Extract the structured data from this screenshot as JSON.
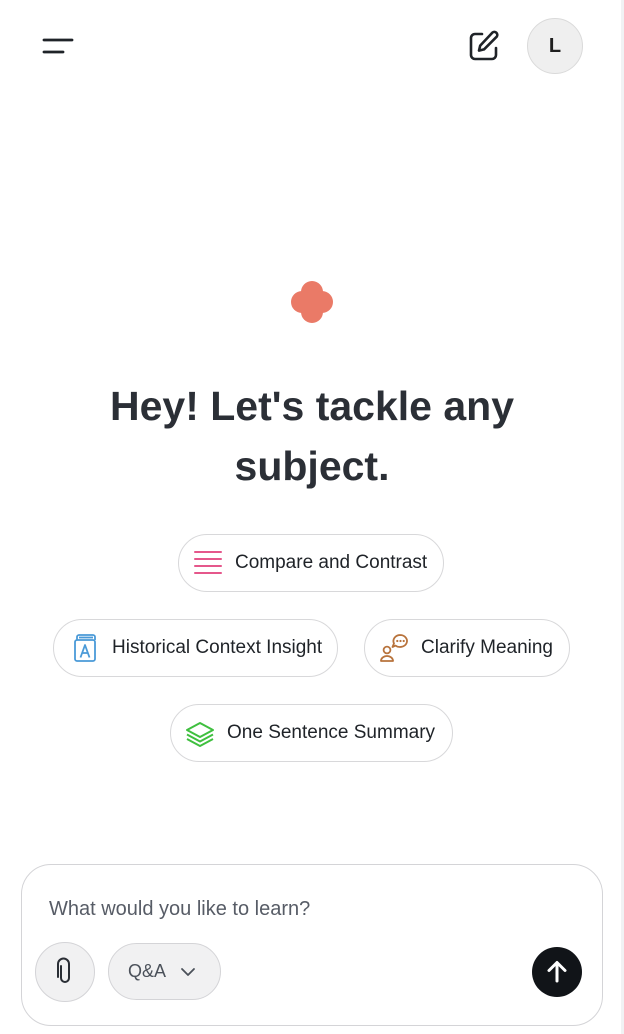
{
  "header": {
    "menu_icon": "menu-icon",
    "new_chat_icon": "edit-icon",
    "avatar_initial": "L"
  },
  "hero": {
    "logo_icon": "flower-logo",
    "logo_color": "#ea7a67",
    "headline": "Hey! Let's tackle any subject."
  },
  "suggestions": [
    {
      "label": "Compare and Contrast",
      "icon": "lines-icon",
      "icon_color": "#e5578b"
    },
    {
      "label": "Historical Context Insight",
      "icon": "book-icon",
      "icon_color": "#4a9ad8"
    },
    {
      "label": "Clarify Meaning",
      "icon": "speech-person-icon",
      "icon_color": "#b8733c"
    },
    {
      "label": "One Sentence Summary",
      "icon": "layers-icon",
      "icon_color": "#3fbf3f"
    }
  ],
  "composer": {
    "placeholder": "What would you like to learn?",
    "value": "",
    "attach_icon": "paperclip-icon",
    "mode": "Q&A",
    "mode_icon": "chevron-down-icon",
    "send_icon": "arrow-up-icon"
  }
}
